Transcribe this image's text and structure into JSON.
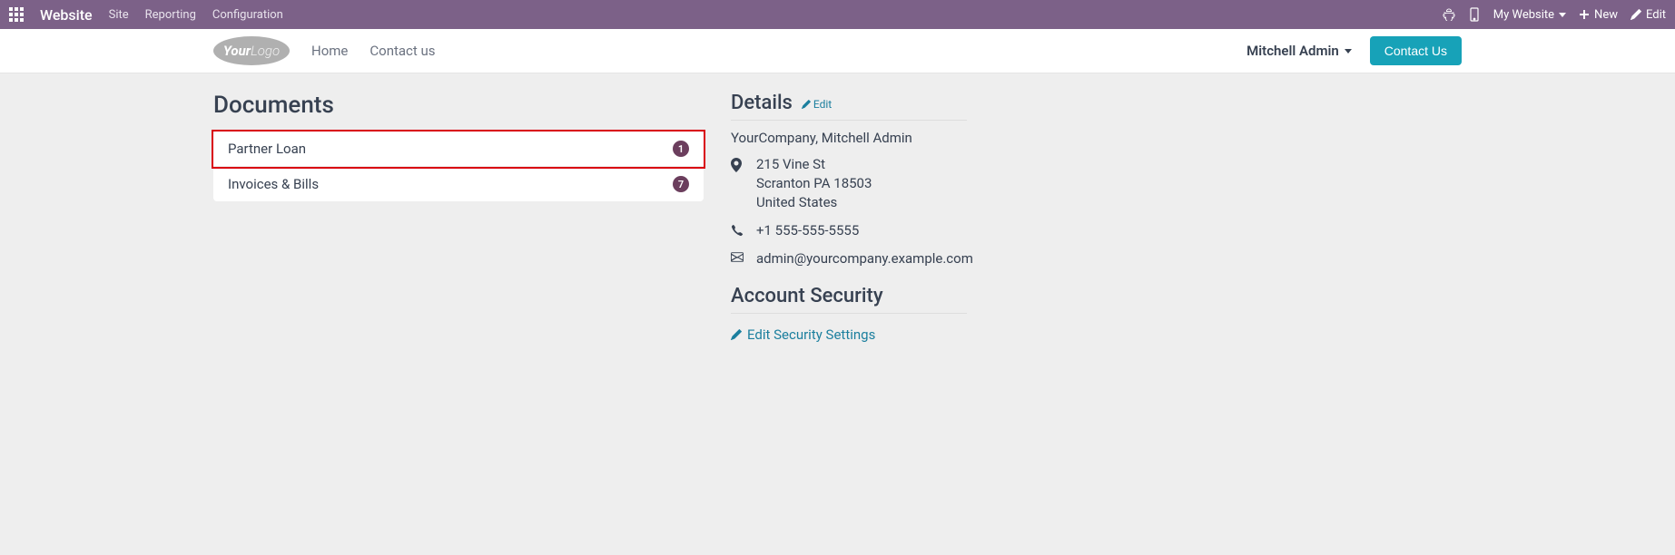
{
  "topbar": {
    "app_name": "Website",
    "menu": [
      "Site",
      "Reporting",
      "Configuration"
    ],
    "website_selector": "My Website",
    "new_label": "New",
    "edit_label": "Edit"
  },
  "navbar": {
    "logo_text_1": "Your",
    "logo_text_2": "Logo",
    "links": [
      "Home",
      "Contact us"
    ],
    "user_name": "Mitchell Admin",
    "contact_btn": "Contact Us"
  },
  "documents": {
    "title": "Documents",
    "items": [
      {
        "label": "Partner Loan",
        "count": "1",
        "highlighted": true
      },
      {
        "label": "Invoices & Bills",
        "count": "7",
        "highlighted": false
      }
    ]
  },
  "details": {
    "title": "Details",
    "edit_label": "Edit",
    "company_line": "YourCompany, Mitchell Admin",
    "address_line1": "215 Vine St",
    "address_line2": "Scranton PA 18503",
    "address_line3": "United States",
    "phone": "+1 555-555-5555",
    "email": "admin@yourcompany.example.com"
  },
  "security": {
    "title": "Account Security",
    "link": "Edit Security Settings"
  }
}
